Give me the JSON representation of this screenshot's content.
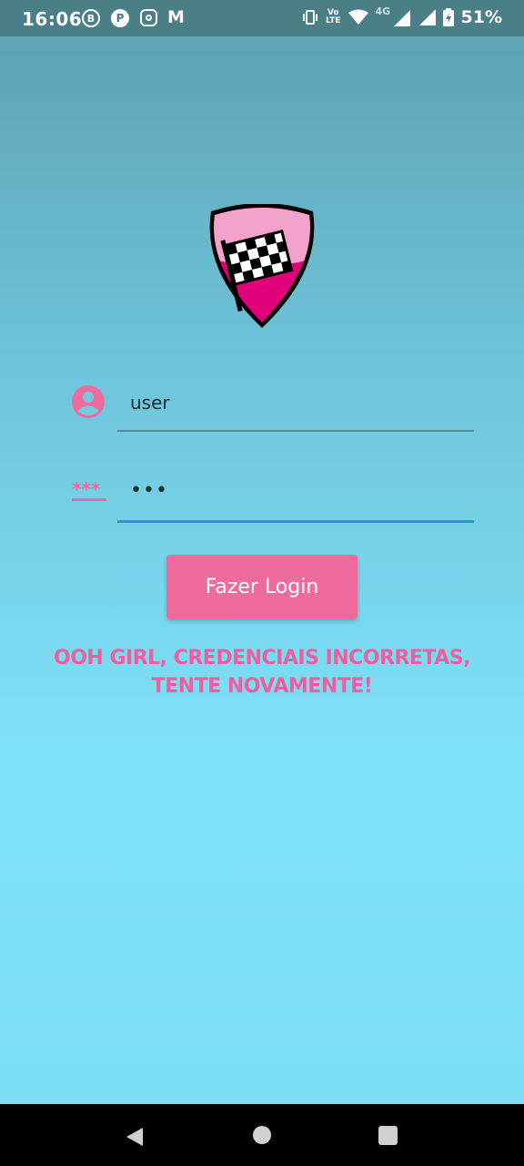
{
  "status_bar": {
    "time": "16:06",
    "notif_b_label": "B",
    "notif_p_label": "P",
    "notif_m_label": "M",
    "volte_top": "Vo",
    "volte_bottom": "LTE",
    "network": "4G",
    "battery": "51%"
  },
  "logo": {
    "icon": "checkered-flag-shield-icon",
    "colors": {
      "shield": "#e0007a",
      "shield_light": "#f2a3cc"
    }
  },
  "form": {
    "username": {
      "icon": "user-icon",
      "value": "user"
    },
    "password": {
      "icon": "password-icon",
      "value": "•••"
    },
    "login_label": "Fazer Login"
  },
  "error": {
    "line1": "OOH GIRL, CREDENCIAIS INCORRETAS,",
    "line2": "TENTE NOVAMENTE!"
  },
  "colors": {
    "accent": "#f06b9d",
    "error": "#ef5fa0",
    "focus": "#2196f3"
  },
  "nav": {
    "back_icon": "back-icon",
    "home_icon": "home-icon",
    "recents_icon": "recents-icon"
  }
}
